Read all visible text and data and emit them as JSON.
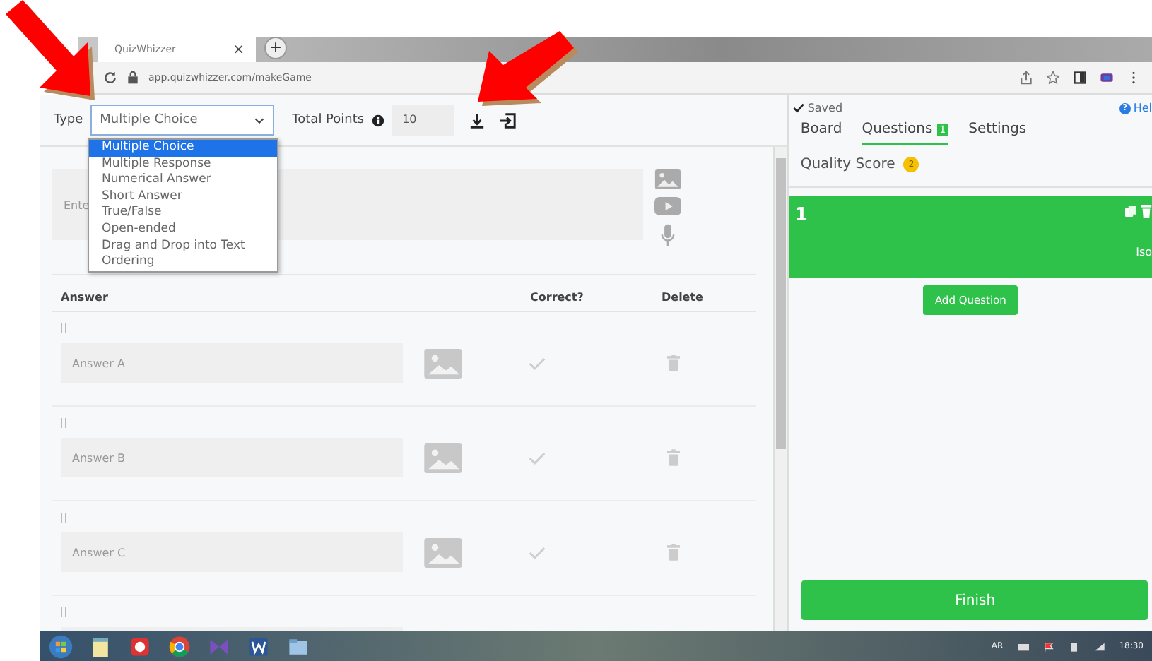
{
  "browser": {
    "tab_title": "QuizWhizzer",
    "tab_close": "×",
    "new_tab": "+",
    "url": "app.quizwhizzer.com/makeGame"
  },
  "toolbar": {
    "type_label": "Type",
    "type_value": "Multiple Choice",
    "points_label": "Total Points",
    "points_value": "10"
  },
  "type_dropdown": [
    {
      "label": "Multiple Choice",
      "selected": true
    },
    {
      "label": "Multiple Response",
      "selected": false
    },
    {
      "label": "Numerical Answer",
      "selected": false
    },
    {
      "label": "Short Answer",
      "selected": false
    },
    {
      "label": "True/False",
      "selected": false
    },
    {
      "label": "Open-ended",
      "selected": false
    },
    {
      "label": "Drag and Drop into Text",
      "selected": false
    },
    {
      "label": "Ordering",
      "selected": false
    }
  ],
  "question": {
    "placeholder": "Ente"
  },
  "answers_table": {
    "columns": [
      "Answer",
      "Correct?",
      "Delete"
    ],
    "rows": [
      {
        "placeholder": "Answer A",
        "correct": false
      },
      {
        "placeholder": "Answer B",
        "correct": false
      },
      {
        "placeholder": "Answer C",
        "correct": false
      }
    ]
  },
  "side_panel": {
    "saved": "Saved",
    "help_icon": "?",
    "help": "Hel",
    "tabs": [
      {
        "label": "Board",
        "selected": false
      },
      {
        "label": "Questions",
        "badge": "1",
        "selected": true
      },
      {
        "label": "Settings",
        "selected": false
      }
    ],
    "quality_label": "Quality Score",
    "quality_badge": "2",
    "question_card": {
      "number": "1",
      "text": "Iso"
    },
    "add_button": "Add Question",
    "finish_button": "Finish"
  },
  "taskbar": {
    "language": "AR",
    "time": "18:30"
  }
}
